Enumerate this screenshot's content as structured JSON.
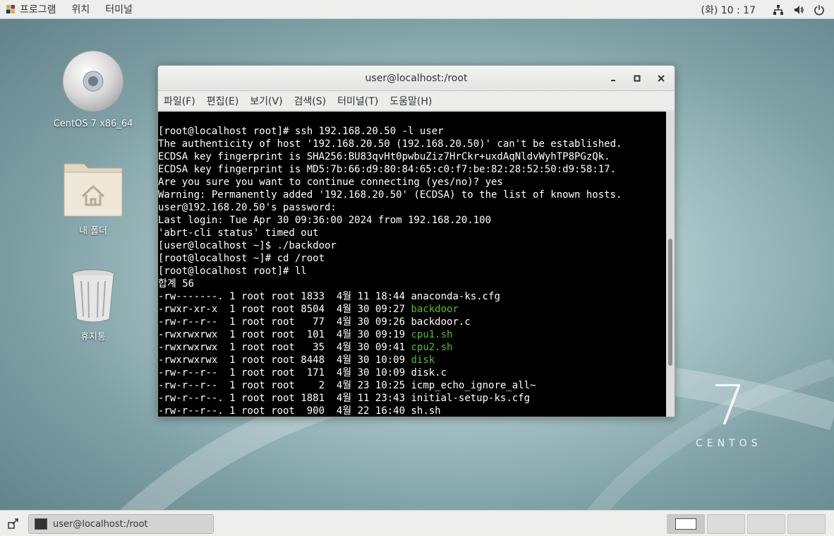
{
  "topbar": {
    "menus": [
      "프로그램",
      "위치",
      "터미널"
    ],
    "clock": "(화) 10 : 17"
  },
  "desktop": {
    "icons": [
      {
        "label": "CentOS 7 x86_64"
      },
      {
        "label": "내 폴더"
      },
      {
        "label": "휴지통"
      }
    ],
    "brand_number": "7",
    "brand_word": "CENTOS"
  },
  "window": {
    "title": "user@localhost:/root",
    "menus": [
      "파일(F)",
      "편집(E)",
      "보기(V)",
      "검색(S)",
      "터미널(T)",
      "도움말(H)"
    ],
    "terminal_lines": [
      {
        "text": "[root@localhost root]# ssh 192.168.20.50 -l user"
      },
      {
        "text": "The authenticity of host '192.168.20.50 (192.168.20.50)' can't be established."
      },
      {
        "text": "ECDSA key fingerprint is SHA256:BU83qvHt0pwbuZiz7HrCkr+uxdAqNldvWyhTP8PGzQk."
      },
      {
        "text": "ECDSA key fingerprint is MD5:7b:66:d9:80:84:65:c0:f7:be:82:28:52:50:d9:58:17."
      },
      {
        "text": "Are you sure you want to continue connecting (yes/no)? yes"
      },
      {
        "text": "Warning: Permanently added '192.168.20.50' (ECDSA) to the list of known hosts."
      },
      {
        "text": "user@192.168.20.50's password:"
      },
      {
        "text": "Last login: Tue Apr 30 09:36:00 2024 from 192.168.20.100"
      },
      {
        "text": "'abrt-cli status' timed out"
      },
      {
        "text": "[user@localhost ~]$ ./backdoor"
      },
      {
        "text": "[root@localhost ~]# cd /root"
      },
      {
        "text": "[root@localhost root]# ll"
      },
      {
        "text": "합계 56"
      },
      {
        "prefix": "-rw-------. 1 root root 1833  4월 11 18:44 ",
        "name": "anaconda-ks.cfg",
        "green": false
      },
      {
        "prefix": "-rwxr-xr-x  1 root root 8504  4월 30 09:27 ",
        "name": "backdoor",
        "green": true
      },
      {
        "prefix": "-rw-r--r--  1 root root   77  4월 30 09:26 ",
        "name": "backdoor.c",
        "green": false
      },
      {
        "prefix": "-rwxrwxrwx  1 root root  101  4월 30 09:19 ",
        "name": "cpu1.sh",
        "green": true
      },
      {
        "prefix": "-rwxrwxrwx  1 root root   35  4월 30 09:41 ",
        "name": "cpu2.sh",
        "green": true
      },
      {
        "prefix": "-rwxrwxrwx  1 root root 8448  4월 30 10:09 ",
        "name": "disk",
        "green": true
      },
      {
        "prefix": "-rw-r--r--  1 root root  171  4월 30 10:09 ",
        "name": "disk.c",
        "green": false
      },
      {
        "prefix": "-rw-r--r--  1 root root    2  4월 23 10:25 ",
        "name": "icmp_echo_ignore_all~",
        "green": false
      },
      {
        "prefix": "-rw-r--r--. 1 root root 1881  4월 11 23:43 ",
        "name": "initial-setup-ks.cfg",
        "green": false
      },
      {
        "prefix": "-rw-r--r--. 1 root root  900  4월 22 16:40 ",
        "name": "sh.sh",
        "green": false
      }
    ]
  },
  "taskbar": {
    "task_label": "user@localhost:/root",
    "workspace_count": 4
  },
  "colors": {
    "terminal_bg": "#000000",
    "terminal_fg": "#ffffff",
    "exec_green": "#4fbf2f"
  }
}
